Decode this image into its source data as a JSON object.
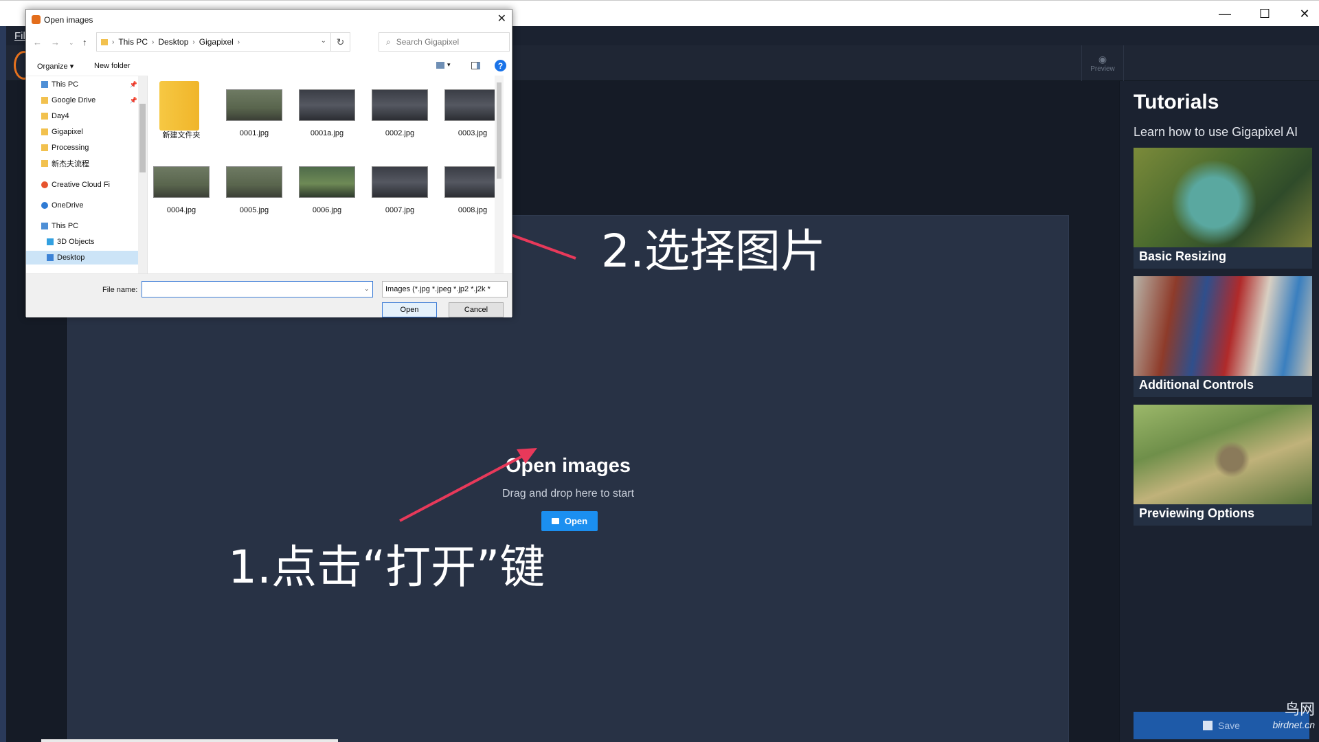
{
  "window": {
    "controls": {
      "minimize": "—",
      "maximize": "☐",
      "close": "✕"
    }
  },
  "menubar": {
    "file_label": "Fil"
  },
  "toolbar": {
    "preview_label": "Preview"
  },
  "dropzone": {
    "title": "Open images",
    "subtitle": "Drag and drop here to start",
    "open_button": "Open"
  },
  "annotations": {
    "step2": "2.选择图片",
    "step1": "1.点击“打开”键"
  },
  "tutorials": {
    "title": "Tutorials",
    "subtitle": "Learn how to use Gigapixel AI",
    "cards": [
      {
        "label": "Basic Resizing"
      },
      {
        "label": "Additional Controls"
      },
      {
        "label": "Previewing Options"
      }
    ],
    "save_label": "Save"
  },
  "watermark": {
    "line1": "鸟网",
    "line2": "birdnet.cn"
  },
  "dialog": {
    "title": "Open images",
    "breadcrumb": [
      "This PC",
      "Desktop",
      "Gigapixel"
    ],
    "search_placeholder": "Search Gigapixel",
    "organize_label": "Organize ▾",
    "new_folder_label": "New folder",
    "help_label": "?",
    "tree": [
      {
        "label": "This PC",
        "icon": "pc-icon"
      },
      {
        "label": "Google Drive",
        "icon": "folder-icon"
      },
      {
        "label": "Day4",
        "icon": "folder-icon"
      },
      {
        "label": "Gigapixel",
        "icon": "folder-icon"
      },
      {
        "label": "Processing",
        "icon": "folder-icon"
      },
      {
        "label": "新杰夫流程",
        "icon": "folder-icon"
      },
      {
        "label": "Creative Cloud Fi",
        "icon": "creative-cloud-icon"
      },
      {
        "label": "OneDrive",
        "icon": "onedrive-icon"
      },
      {
        "label": "This PC",
        "icon": "pc-icon"
      },
      {
        "label": "3D Objects",
        "icon": "3d-objects-icon"
      },
      {
        "label": "Desktop",
        "icon": "desktop-icon"
      }
    ],
    "files": [
      {
        "name": "新建文件夹",
        "kind": "folder"
      },
      {
        "name": "0001.jpg",
        "kind": "duck"
      },
      {
        "name": "0001a.jpg",
        "kind": "dark"
      },
      {
        "name": "0002.jpg",
        "kind": "dark"
      },
      {
        "name": "0003.jpg",
        "kind": "dark"
      },
      {
        "name": "0004.jpg",
        "kind": "duck"
      },
      {
        "name": "0005.jpg",
        "kind": "duck"
      },
      {
        "name": "0006.jpg",
        "kind": "green"
      },
      {
        "name": "0007.jpg",
        "kind": "dark"
      },
      {
        "name": "0008.jpg",
        "kind": "dark"
      }
    ],
    "file_name_label": "File name:",
    "file_name_value": "",
    "file_type": "Images (*.jpg *.jpeg *.jp2 *.j2k *",
    "open_label": "Open",
    "cancel_label": "Cancel"
  },
  "colors": {
    "accent": "#1b8ff0",
    "annotation_arrow": "#e8395a",
    "panel_bg": "#1b2230",
    "dropzone_bg": "#283245"
  }
}
